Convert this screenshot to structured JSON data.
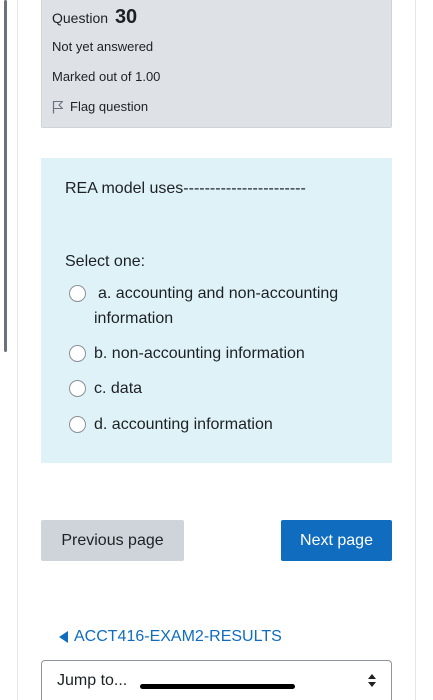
{
  "question_info": {
    "label": "Question",
    "number": "30",
    "state": "Not yet answered",
    "grade": "Marked out of 1.00",
    "flag_label": "Flag question"
  },
  "question": {
    "text": "REA model uses-----------------------",
    "prompt": "Select one:",
    "options": [
      {
        "label": "a. accounting and non-accounting information",
        "selected": false
      },
      {
        "label": "b. non-accounting information",
        "selected": false
      },
      {
        "label": "c. data",
        "selected": false
      },
      {
        "label": "d. accounting information",
        "selected": false
      }
    ]
  },
  "navigation": {
    "previous_label": "Previous page",
    "next_label": "Next page"
  },
  "results_link": "ACCT416-EXAM2-RESULTS",
  "jump": {
    "label": "Jump to..."
  },
  "colors": {
    "info_bg": "#dee2e6",
    "content_bg": "#def2f8",
    "primary": "#0f6cbf",
    "secondary_button": "#ced4da"
  }
}
